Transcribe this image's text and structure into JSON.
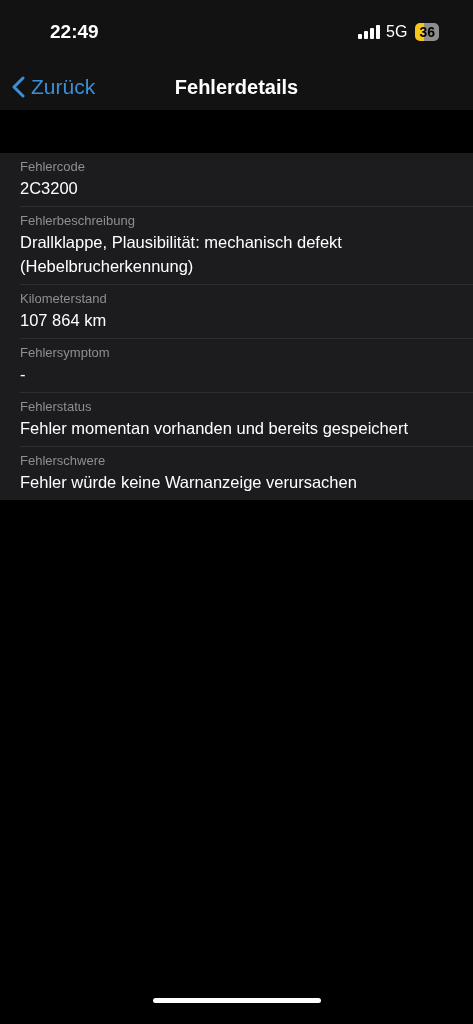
{
  "status_bar": {
    "time": "22:49",
    "network": "5G",
    "battery": "36"
  },
  "nav": {
    "back": "Zurück",
    "title": "Fehlerdetails"
  },
  "rows": [
    {
      "label": "Fehlercode",
      "value": "2C3200"
    },
    {
      "label": "Fehlerbeschreibung",
      "value": "Drallklappe, Plausibilität: mechanisch defekt (Hebelbrucherkennung)"
    },
    {
      "label": "Kilometerstand",
      "value": "107 864 km"
    },
    {
      "label": "Fehlersymptom",
      "value": "-"
    },
    {
      "label": "Fehlerstatus",
      "value": "Fehler momentan vorhanden und bereits gespeichert"
    },
    {
      "label": "Fehlerschwere",
      "value": "Fehler würde keine Warnanzeige verursachen"
    }
  ]
}
